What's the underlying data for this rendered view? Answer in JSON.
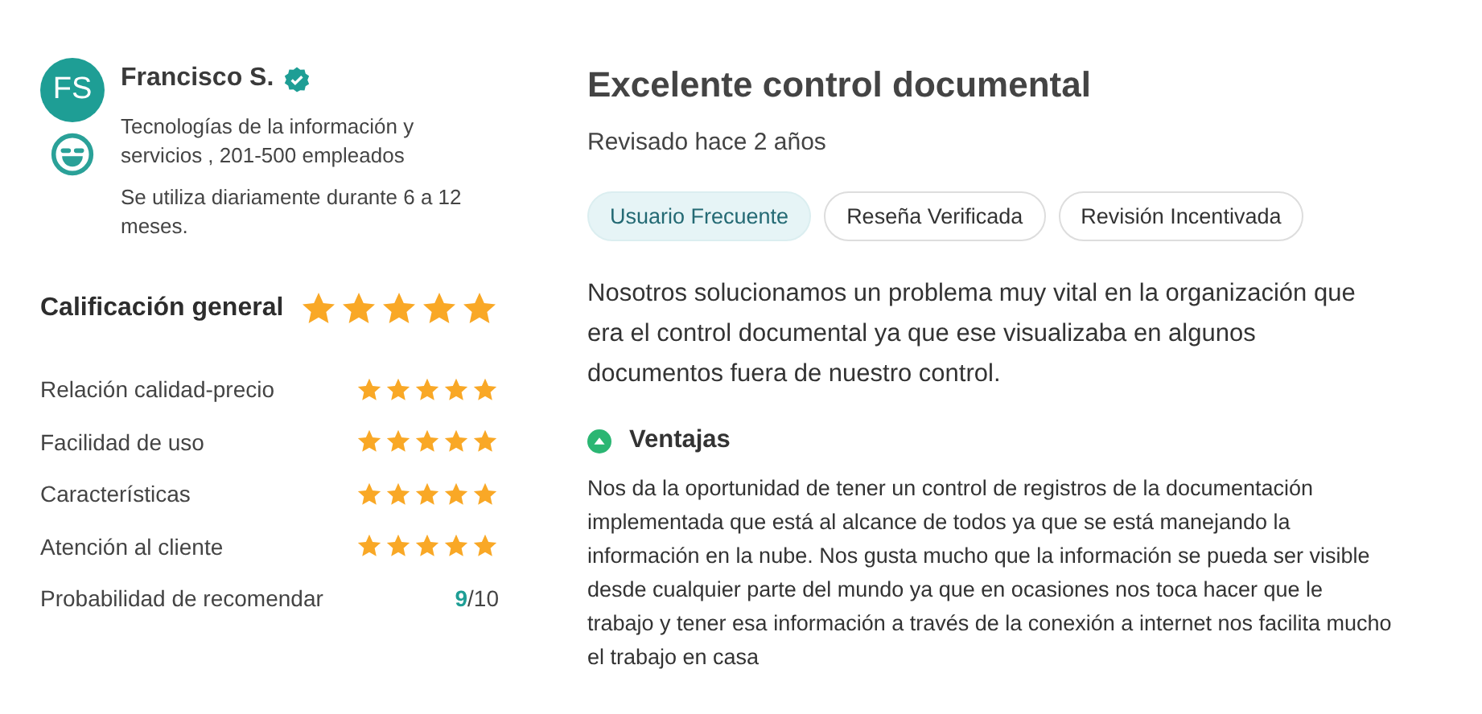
{
  "reviewer": {
    "initials": "FS",
    "name": "Francisco S.",
    "verified": true,
    "company": "Tecnologías de la información y servicios , 201-500 empleados",
    "usage": "Se utiliza diariamente durante 6 a 12 meses."
  },
  "overall": {
    "label": "Calificación general",
    "stars": 5
  },
  "ratings": [
    {
      "kind": "stars",
      "label": "Relación calidad-precio",
      "stars": 5
    },
    {
      "kind": "stars",
      "label": "Facilidad de uso",
      "stars": 5
    },
    {
      "kind": "stars",
      "label": "Características",
      "stars": 5
    },
    {
      "kind": "stars",
      "label": "Atención al cliente",
      "stars": 5
    },
    {
      "kind": "score",
      "label": "Probabilidad de recomendar",
      "score": "9",
      "out_of": "/10"
    }
  ],
  "review": {
    "title": "Excelente control documental",
    "date": "Revisado hace 2 años",
    "tags": [
      {
        "label": "Usuario Frecuente",
        "highlighted": true
      },
      {
        "label": "Reseña Verificada",
        "highlighted": false
      },
      {
        "label": "Revisión Incentivada",
        "highlighted": false
      }
    ],
    "summary": "Nosotros solucionamos un problema muy vital en la organización que era el control documental ya que ese visualizaba en algunos documentos fuera de nuestro control.",
    "pros": {
      "heading": "Ventajas",
      "text": "Nos da la oportunidad de tener un control de registros de la documentación implementada que está al alcance de todos ya que se está manejando la información en la nube. Nos gusta mucho que la información se pueda ser visible desde cualquier parte del mundo ya que en ocasiones nos toca hacer que le trabajo y tener esa información a través de la conexión a internet nos facilita mucho el trabajo en casa"
    }
  }
}
